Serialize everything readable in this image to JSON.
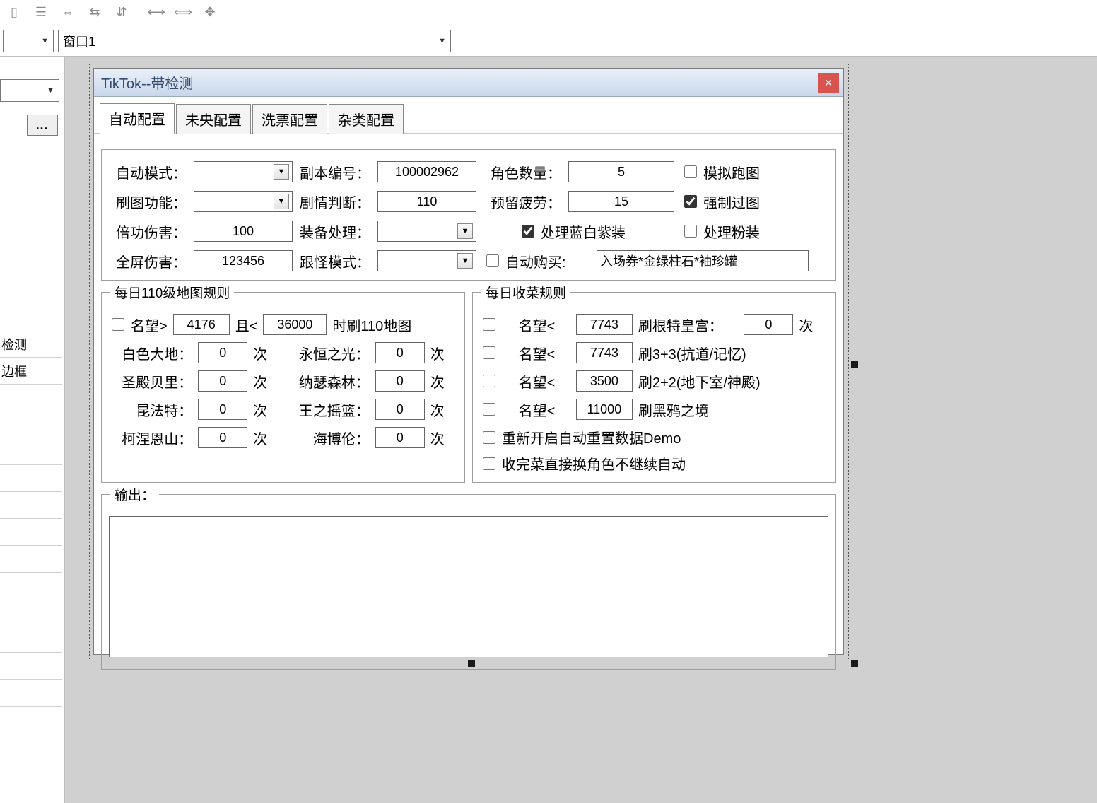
{
  "top_combo_label": "窗口1",
  "left_panel": {
    "items": [
      "检测",
      "边框"
    ]
  },
  "window": {
    "title": "TikTok--带检测",
    "close": "×",
    "tabs": [
      "自动配置",
      "未央配置",
      "洗票配置",
      "杂类配置"
    ],
    "section_top": {
      "auto_mode_label": "自动模式：",
      "dungeon_id_label": "副本编号：",
      "dungeon_id": "100002962",
      "role_count_label": "角色数量：",
      "role_count": "5",
      "simulate_run_label": "模拟跑图",
      "brush_func_label": "刷图功能：",
      "plot_judge_label": "剧情判断：",
      "plot_judge": "110",
      "reserve_fatigue_label": "预留疲劳：",
      "reserve_fatigue": "15",
      "force_map_label": "强制过图",
      "force_map_checked": true,
      "double_dmg_label": "倍功伤害：",
      "double_dmg": "100",
      "equip_proc_label": "装备处理：",
      "proc_bluewhite_label": "处理蓝白紫装",
      "proc_bluewhite_checked": true,
      "proc_pink_label": "处理粉装",
      "full_dmg_label": "全屏伤害：",
      "full_dmg": "123456",
      "track_mode_label": "跟怪模式：",
      "auto_buy_label": "自动购买:",
      "auto_buy_value": "入场券*金绿柱石*袖珍罐"
    },
    "group_map": {
      "legend": "每日110级地图规则",
      "reputation_gt_label": "名望>",
      "rep_min": "4176",
      "and_lt_label": "且<",
      "rep_max": "36000",
      "suffix": "时刷110地图",
      "baise_label": "白色大地：",
      "baise": "0",
      "yongheng_label": "永恒之光：",
      "yongheng": "0",
      "shengdian_label": "圣殿贝里：",
      "shengdian": "0",
      "nase_label": "纳瑟森林：",
      "nase": "0",
      "kunfa_label": "昆法特：",
      "kunfa": "0",
      "wangzhi_label": "王之摇篮：",
      "wangzhi": "0",
      "kenis_label": "柯涅恩山：",
      "kenis": "0",
      "haibo_label": "海博伦：",
      "haibo": "0",
      "times_unit": "次"
    },
    "group_harvest": {
      "legend": "每日收菜规则",
      "rep_lt_label": "名望<",
      "r1_val": "7743",
      "r1_text": "刷根特皇宫：",
      "r1_count": "0",
      "r2_val": "7743",
      "r2_text": "刷3+3(抗道/记忆)",
      "r3_val": "3500",
      "r3_text": "刷2+2(地下室/神殿)",
      "r4_val": "11000",
      "r4_text": "刷黑鸦之境",
      "restart_demo_label": "重新开启自动重置数据Demo",
      "finish_switch_label": "收完菜直接换角色不继续自动",
      "times_unit": "次"
    },
    "output_legend": "输出："
  }
}
